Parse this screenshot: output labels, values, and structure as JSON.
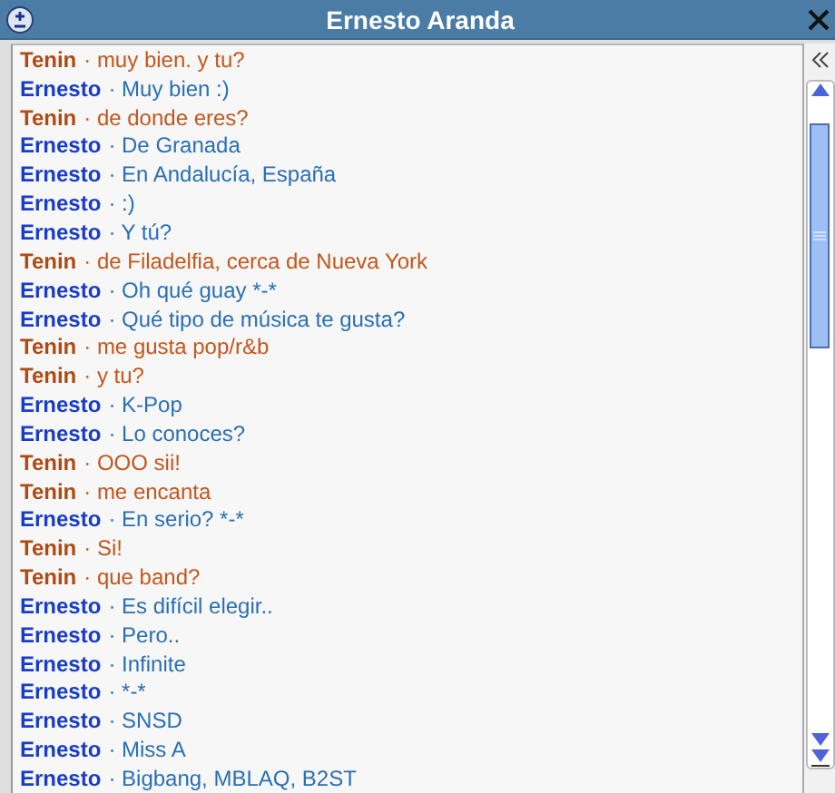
{
  "window": {
    "title": "Ernesto Aranda"
  },
  "messages": [
    {
      "kind": "other",
      "author": "Tenin",
      "text": "· muy bien. y tu?"
    },
    {
      "kind": "self",
      "author": "Ernesto",
      "text": "· Muy bien :)"
    },
    {
      "kind": "other",
      "author": "Tenin",
      "text": "· de donde eres?"
    },
    {
      "kind": "self",
      "author": "Ernesto",
      "text": "· De Granada"
    },
    {
      "kind": "self",
      "author": "Ernesto",
      "text": "· En Andalucía, España"
    },
    {
      "kind": "self",
      "author": "Ernesto",
      "text": "· :)"
    },
    {
      "kind": "self",
      "author": "Ernesto",
      "text": "· Y tú?"
    },
    {
      "kind": "other",
      "author": "Tenin",
      "text": "· de Filadelfia, cerca de Nueva York"
    },
    {
      "kind": "self",
      "author": "Ernesto",
      "text": "· Oh qué guay *-*"
    },
    {
      "kind": "self",
      "author": "Ernesto",
      "text": "· Qué tipo de música te gusta?"
    },
    {
      "kind": "other",
      "author": "Tenin",
      "text": "· me gusta pop/r&b"
    },
    {
      "kind": "other",
      "author": "Tenin",
      "text": "· y tu?"
    },
    {
      "kind": "self",
      "author": "Ernesto",
      "text": "· K-Pop"
    },
    {
      "kind": "self",
      "author": "Ernesto",
      "text": "· Lo conoces?"
    },
    {
      "kind": "other",
      "author": "Tenin",
      "text": "· OOO sii!"
    },
    {
      "kind": "other",
      "author": "Tenin",
      "text": "· me encanta"
    },
    {
      "kind": "self",
      "author": "Ernesto",
      "text": "· En serio? *-*"
    },
    {
      "kind": "other",
      "author": "Tenin",
      "text": "· Si!"
    },
    {
      "kind": "other",
      "author": "Tenin",
      "text": "· que band?"
    },
    {
      "kind": "self",
      "author": "Ernesto",
      "text": "· Es difícil elegir.."
    },
    {
      "kind": "self",
      "author": "Ernesto",
      "text": "· Pero.."
    },
    {
      "kind": "self",
      "author": "Ernesto",
      "text": "· Infinite"
    },
    {
      "kind": "self",
      "author": "Ernesto",
      "text": "· *-*"
    },
    {
      "kind": "self",
      "author": "Ernesto",
      "text": "· SNSD"
    },
    {
      "kind": "self",
      "author": "Ernesto",
      "text": "· Miss A"
    },
    {
      "kind": "self",
      "author": "Ernesto",
      "text": "· Bigbang, MBLAQ, B2ST"
    }
  ]
}
